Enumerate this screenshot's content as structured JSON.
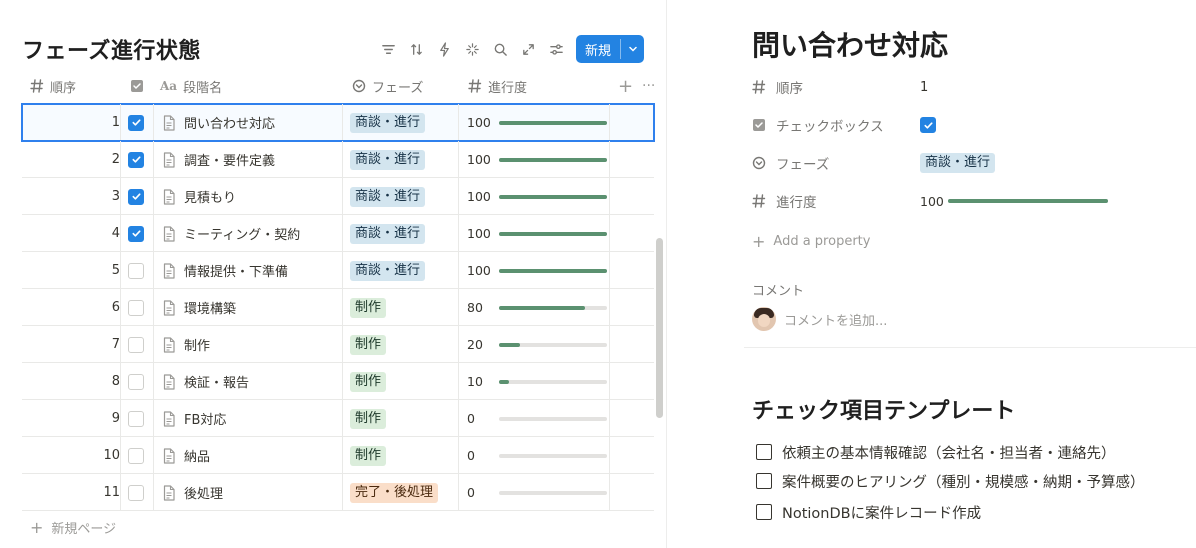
{
  "database": {
    "title": "フェーズ進行状態",
    "new_button": "新規",
    "columns": {
      "order": "順序",
      "name": "段階名",
      "phase": "フェーズ",
      "progress": "進行度"
    },
    "rows": [
      {
        "order": "1",
        "checked": true,
        "name": "問い合わせ対応",
        "phase": "商談・進行",
        "progress": "100"
      },
      {
        "order": "2",
        "checked": true,
        "name": "調査・要件定義",
        "phase": "商談・進行",
        "progress": "100"
      },
      {
        "order": "3",
        "checked": true,
        "name": "見積もり",
        "phase": "商談・進行",
        "progress": "100"
      },
      {
        "order": "4",
        "checked": true,
        "name": "ミーティング・契約",
        "phase": "商談・進行",
        "progress": "100"
      },
      {
        "order": "5",
        "checked": false,
        "name": "情報提供・下準備",
        "phase": "商談・進行",
        "progress": "100"
      },
      {
        "order": "6",
        "checked": false,
        "name": "環境構築",
        "phase": "制作",
        "progress": "80"
      },
      {
        "order": "7",
        "checked": false,
        "name": "制作",
        "phase": "制作",
        "progress": "20"
      },
      {
        "order": "8",
        "checked": false,
        "name": "検証・報告",
        "phase": "制作",
        "progress": "10"
      },
      {
        "order": "9",
        "checked": false,
        "name": "FB対応",
        "phase": "制作",
        "progress": "0"
      },
      {
        "order": "10",
        "checked": false,
        "name": "納品",
        "phase": "制作",
        "progress": "0"
      },
      {
        "order": "11",
        "checked": false,
        "name": "後処理",
        "phase": "完了・後処理",
        "progress": "0"
      }
    ],
    "new_page": "新規ページ"
  },
  "phase_colors": {
    "商談・進行": {
      "bg": "#d3e5ef",
      "fg": "#183347"
    },
    "制作": {
      "bg": "#dbeddb",
      "fg": "#1c3829"
    },
    "完了・後処理": {
      "bg": "#fadec9",
      "fg": "#49290e"
    }
  },
  "colors": {
    "accent": "#2383e2",
    "progress_bar": "#5b9170"
  },
  "page": {
    "title": "問い合わせ対応",
    "properties": {
      "order_label": "順序",
      "order_value": "1",
      "checkbox_label": "チェックボックス",
      "checkbox_checked": true,
      "phase_label": "フェーズ",
      "phase_value": "商談・進行",
      "progress_label": "進行度",
      "progress_value": "100"
    },
    "add_property": "Add a property",
    "comment_heading": "コメント",
    "comment_placeholder": "コメントを追加...",
    "template_title": "チェック項目テンプレート",
    "todos": [
      "依頼主の基本情報確認（会社名・担当者・連絡先）",
      "案件概要のヒアリング（種別・規模感・納期・予算感）",
      "NotionDBに案件レコード作成"
    ]
  }
}
